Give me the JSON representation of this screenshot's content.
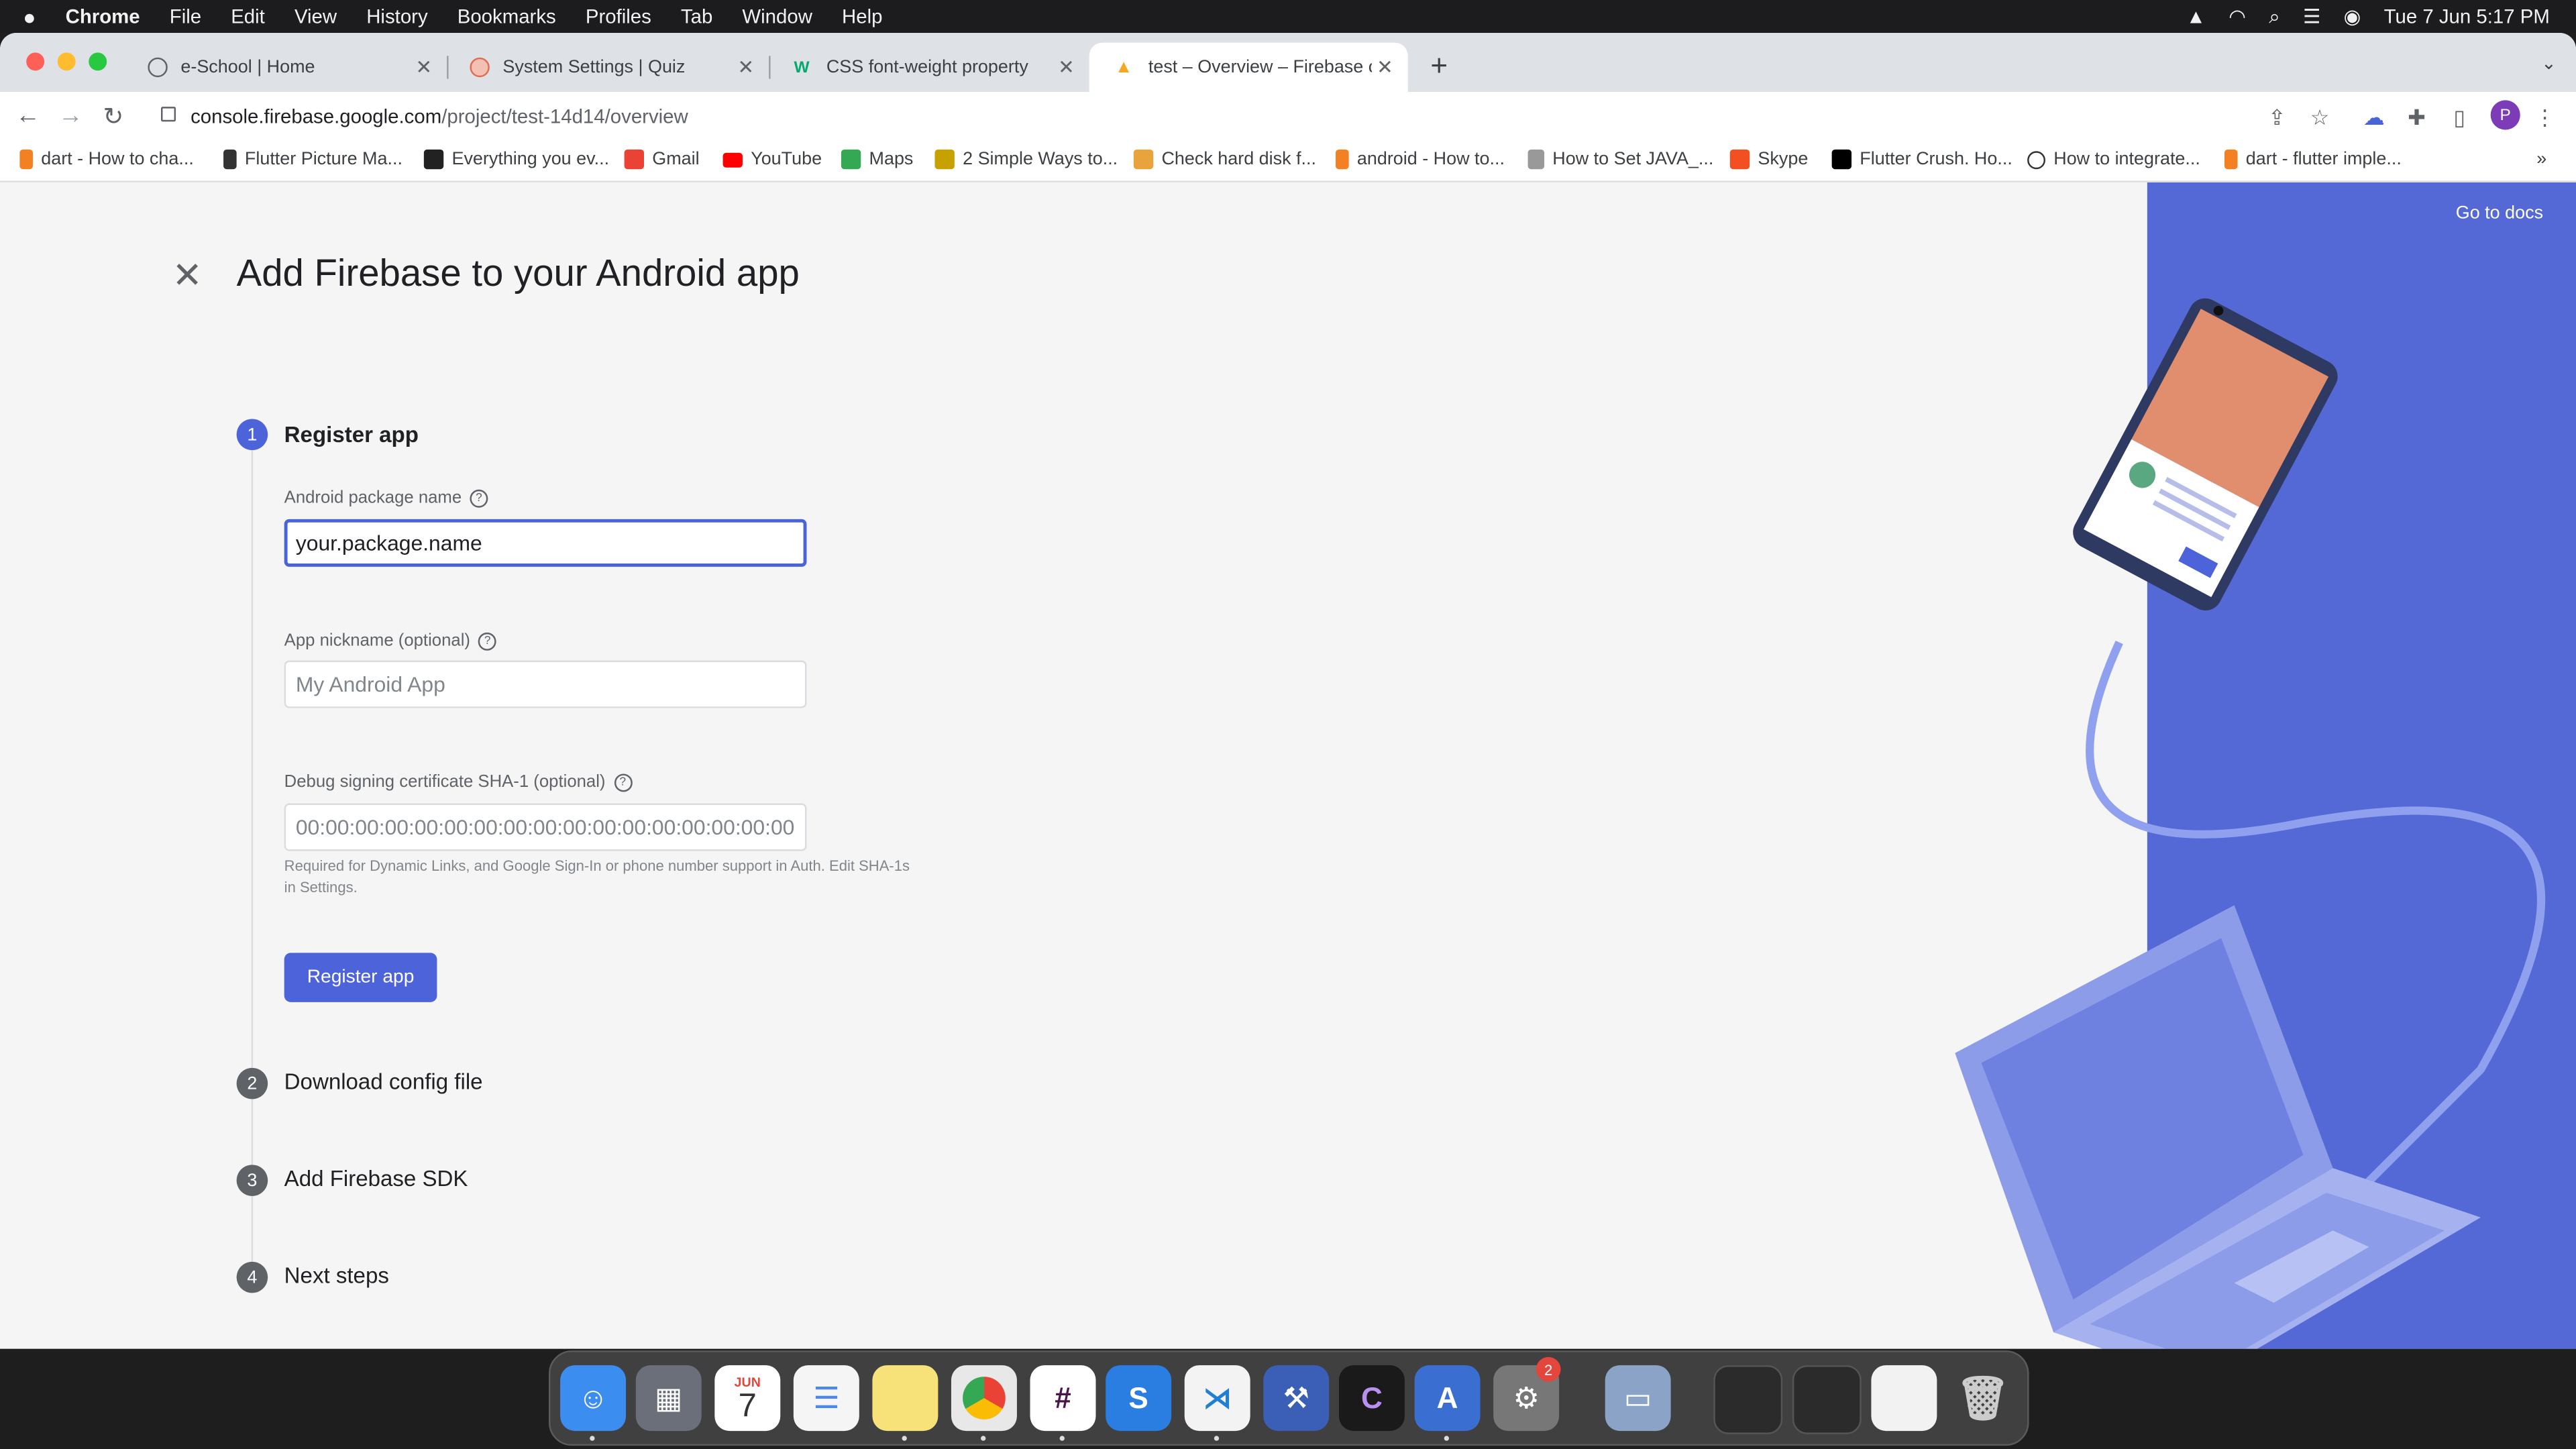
{
  "menubar": {
    "app": "Chrome",
    "items": [
      "File",
      "Edit",
      "View",
      "History",
      "Bookmarks",
      "Profiles",
      "Tab",
      "Window",
      "Help"
    ],
    "clock": "Tue 7 Jun  5:17 PM"
  },
  "tabs": [
    {
      "title": "e-School | Home"
    },
    {
      "title": "System Settings | Quiz"
    },
    {
      "title": "CSS font-weight property"
    },
    {
      "title": "test – Overview – Firebase con"
    }
  ],
  "address_bar": {
    "domain": "console.firebase.google.com",
    "path": "/project/test-14d14/overview"
  },
  "profile_initial": "P",
  "bookmarks": [
    "dart - How to cha...",
    "Flutter Picture Ma...",
    "Everything you ev...",
    "Gmail",
    "YouTube",
    "Maps",
    "2 Simple Ways to...",
    "Check hard disk f...",
    "android - How to...",
    "How to Set JAVA_...",
    "Skype",
    "Flutter Crush. Ho...",
    "How to integrate...",
    "dart - flutter imple..."
  ],
  "page": {
    "title": "Add Firebase to your Android app",
    "go_to_docs": "Go to docs",
    "steps": [
      {
        "number": "1",
        "label": "Register app"
      },
      {
        "number": "2",
        "label": "Download config file"
      },
      {
        "number": "3",
        "label": "Add Firebase SDK"
      },
      {
        "number": "4",
        "label": "Next steps"
      }
    ],
    "package_name": {
      "label": "Android package name",
      "value": "your.package.name"
    },
    "nickname": {
      "label": "App nickname (optional)",
      "placeholder": "My Android App"
    },
    "sha1": {
      "label": "Debug signing certificate SHA-1 (optional)",
      "placeholder": "00:00:00:00:00:00:00:00:00:00:00:00:00:00:00:00:00:00:00:00",
      "hint": "Required for Dynamic Links, and Google Sign-In or phone number support in Auth. Edit SHA-1s in Settings."
    },
    "register_button": "Register app"
  },
  "dock": {
    "calendar_month": "JUN",
    "calendar_day": "7",
    "settings_badge": "2"
  },
  "colors": {
    "accent": "#4c63d9",
    "promo": "#5468d6",
    "step_active": "#4c63d9",
    "step_inactive": "#5f6368"
  }
}
